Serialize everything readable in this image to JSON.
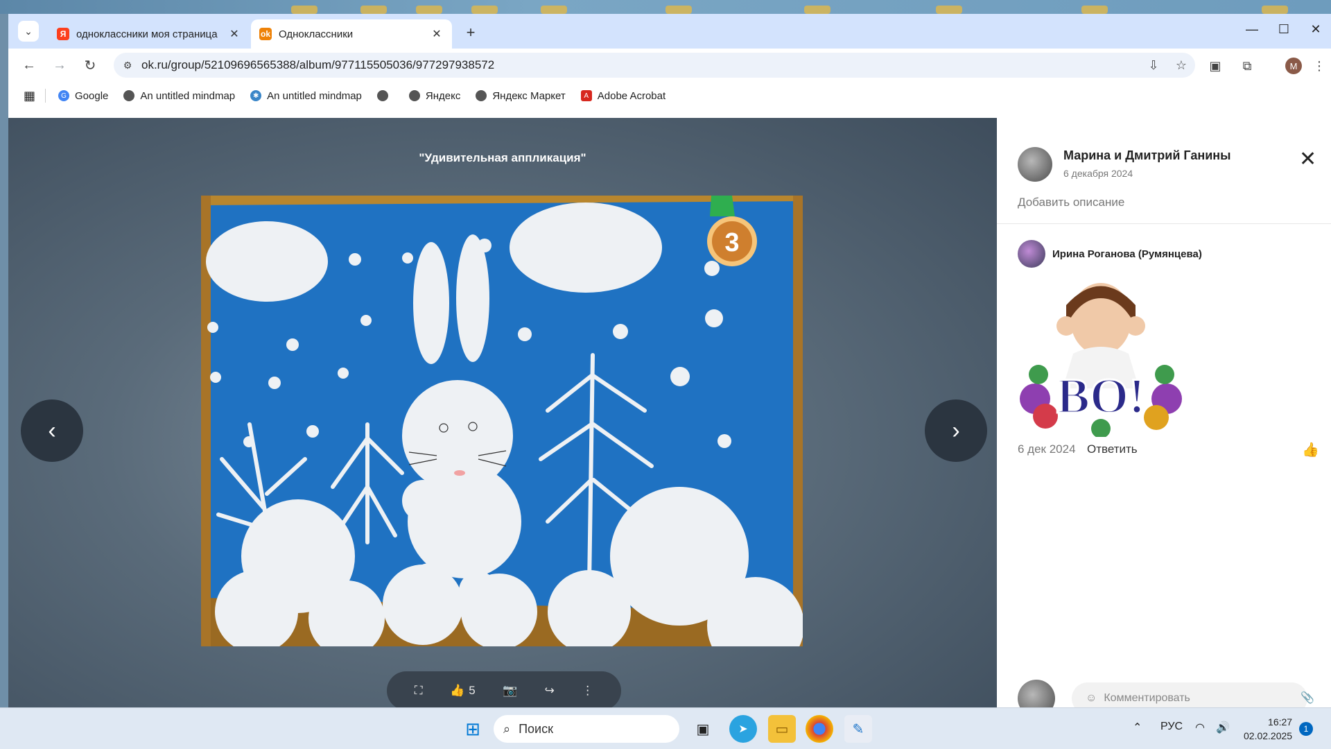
{
  "tabs": [
    {
      "title": "одноклассники моя страница",
      "favicon": "yandex-icon",
      "active": false
    },
    {
      "title": "Одноклассники",
      "favicon": "ok-icon",
      "active": true
    }
  ],
  "address_bar": {
    "url": "ok.ru/group/52109696565388/album/977115505036/977297938572"
  },
  "bookmarks": [
    {
      "label": "Google",
      "icon": "google-icon"
    },
    {
      "label": "An untitled mindmap",
      "icon": "globe-icon"
    },
    {
      "label": "An untitled mindmap",
      "icon": "mindmap-icon"
    },
    {
      "label": "",
      "icon": "globe-icon"
    },
    {
      "label": "Яндекс",
      "icon": "globe-icon"
    },
    {
      "label": "Яндекс Маркет",
      "icon": "globe-icon"
    },
    {
      "label": "Adobe Acrobat",
      "icon": "acrobat-icon"
    }
  ],
  "profile_letter": "M",
  "viewer": {
    "title": "\"Удивительная аппликация\"",
    "likes": "5",
    "medal": "3"
  },
  "side": {
    "owner_name": "Марина и Дмитрий Ганины",
    "owner_date": "6 декабря 2024",
    "add_description": "Добавить описание",
    "comment": {
      "author": "Ирина Роганова (Румянцева)",
      "sticker_text": "ВО!",
      "date": "6 дек 2024",
      "reply": "Ответить"
    },
    "comment_placeholder": "Комментировать"
  },
  "taskbar": {
    "search": "Поиск",
    "lang": "РУС",
    "time": "16:27",
    "date": "02.02.2025",
    "notifications": "1"
  },
  "colors": {
    "ok_orange": "#ee8208",
    "photo_blue": "#1f72c2",
    "chrome_tab": "#d3e3fd"
  }
}
